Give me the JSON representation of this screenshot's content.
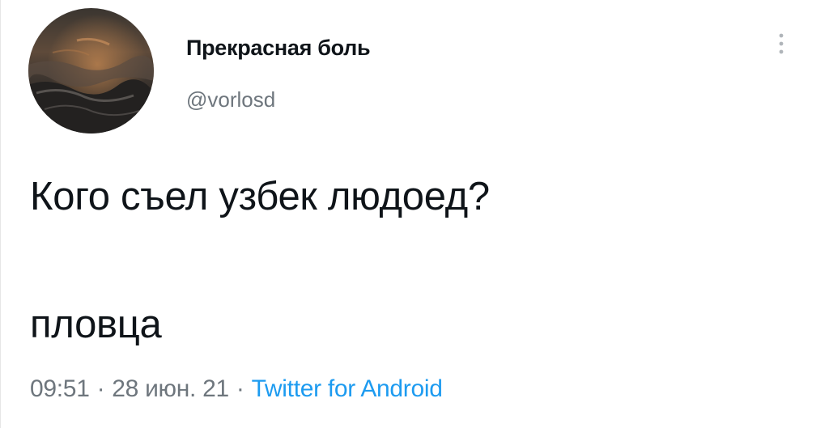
{
  "user": {
    "display_name": "Прекрасная боль",
    "handle": "@vorlosd"
  },
  "tweet": {
    "line1": "Кого съел узбек людоед?",
    "line2": "пловца"
  },
  "meta": {
    "time": "09:51",
    "separator": "·",
    "date": "28 июн. 21",
    "source": "Twitter for Android"
  },
  "colors": {
    "text": "#0f1419",
    "secondary": "#6e767d",
    "link": "#1d9bf0"
  },
  "icons": {
    "menu": "more-vertical-icon"
  }
}
